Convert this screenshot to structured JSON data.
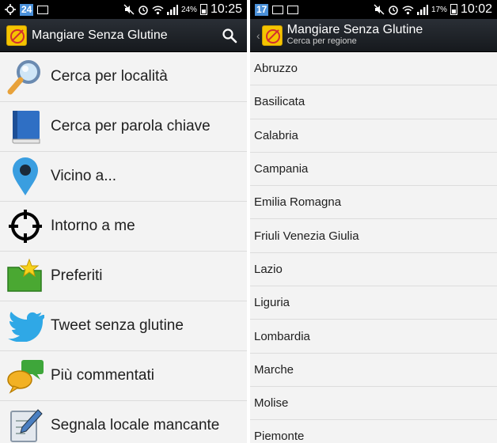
{
  "left": {
    "status": {
      "badge": "24",
      "battery": "24%",
      "time": "10:25"
    },
    "app_title": "Mangiare Senza Glutine",
    "menu": [
      {
        "label": "Cerca per località",
        "icon": "magnifier-icon"
      },
      {
        "label": "Cerca per parola chiave",
        "icon": "book-icon"
      },
      {
        "label": "Vicino a...",
        "icon": "map-pin-icon"
      },
      {
        "label": "Intorno a me",
        "icon": "crosshair-icon"
      },
      {
        "label": "Preferiti",
        "icon": "favorites-folder-icon"
      },
      {
        "label": "Tweet senza glutine",
        "icon": "twitter-bird-icon"
      },
      {
        "label": "Più commentati",
        "icon": "comments-icon"
      },
      {
        "label": "Segnala locale mancante",
        "icon": "report-edit-icon"
      }
    ]
  },
  "right": {
    "status": {
      "badge": "17",
      "battery": "17%",
      "time": "10:02"
    },
    "app_title": "Mangiare Senza Glutine",
    "subtitle": "Cerca per regione",
    "regions": [
      "Abruzzo",
      "Basilicata",
      "Calabria",
      "Campania",
      "Emilia Romagna",
      "Friuli Venezia Giulia",
      "Lazio",
      "Liguria",
      "Lombardia",
      "Marche",
      "Molise",
      "Piemonte"
    ]
  },
  "colors": {
    "actionbar": "#1c2025",
    "accent_blue": "#4a90d9",
    "list_bg": "#f3f3f3"
  }
}
